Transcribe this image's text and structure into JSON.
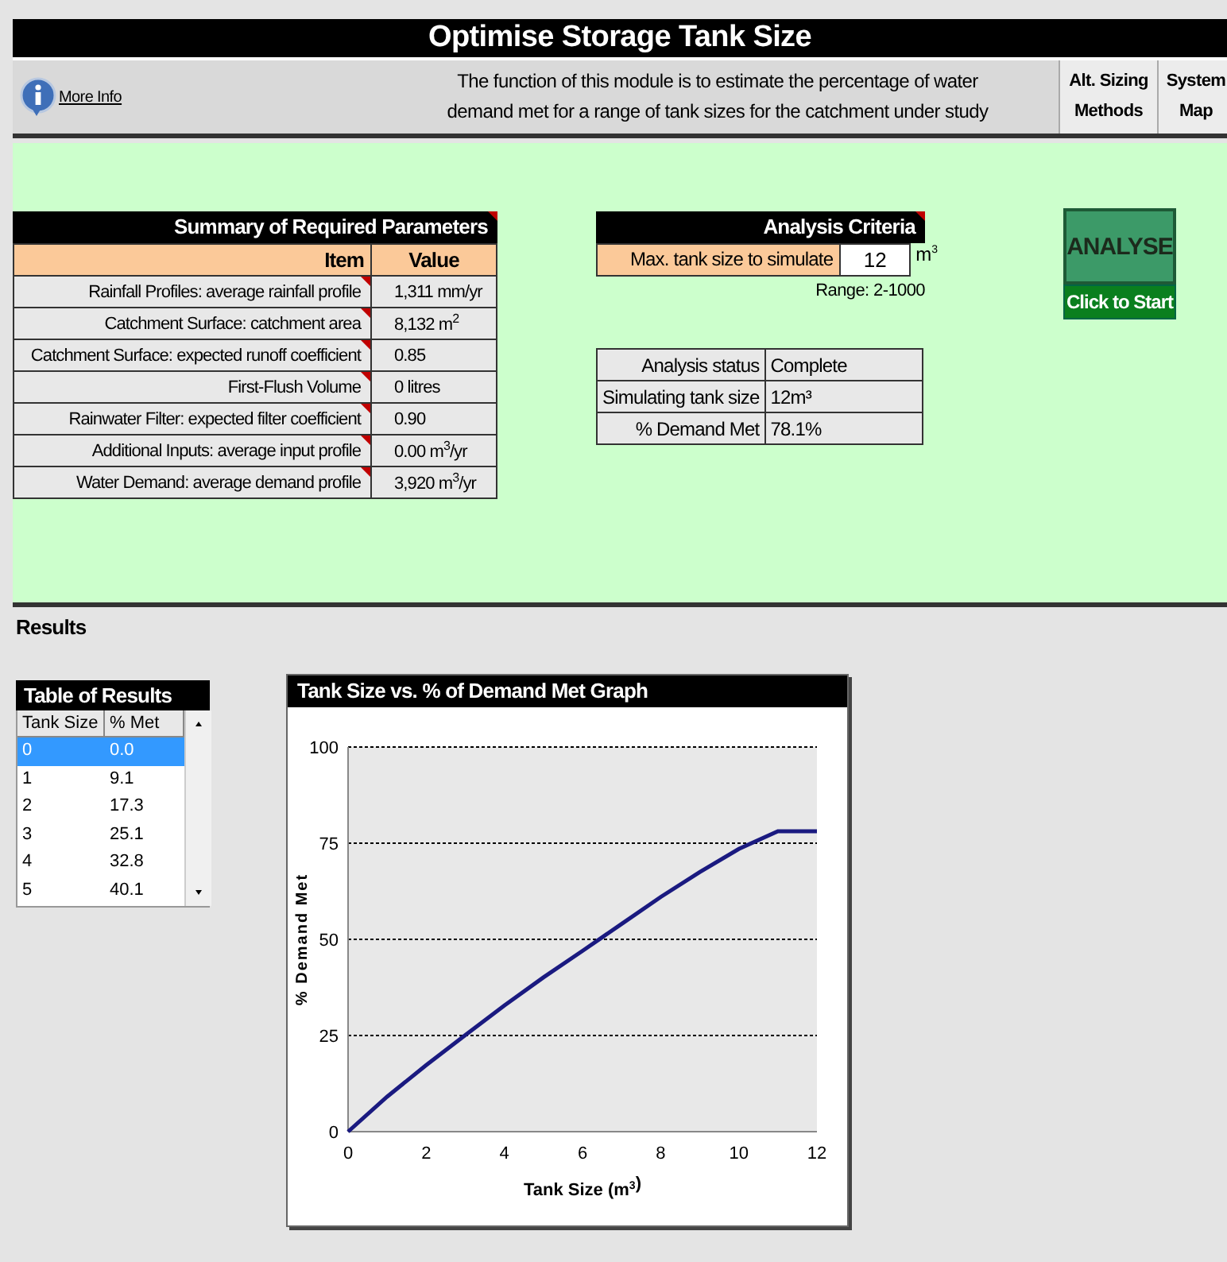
{
  "title": "Optimise Storage Tank Size",
  "info_link": "More Info",
  "description_lines": [
    "The function of this module is to estimate the percentage of water",
    "demand met for a range of tank sizes for the catchment under study"
  ],
  "nav_buttons": [
    {
      "lines": [
        "Alt. Sizing",
        "Methods"
      ]
    },
    {
      "lines": [
        "System",
        "Map"
      ]
    }
  ],
  "summary": {
    "title": "Summary of Required Parameters",
    "has_comment": true,
    "columns": [
      "Item",
      "Value"
    ],
    "rows": [
      {
        "item": "Rainfall Profiles: average rainfall profile",
        "value": "1,311 mm/yr",
        "has_comment": true
      },
      {
        "item": "Catchment Surface: catchment area",
        "value": "8,132 m$^{2}$",
        "has_comment": true
      },
      {
        "item": "Catchment Surface: expected runoff coefficient",
        "value": "0.85",
        "has_comment": true
      },
      {
        "item": "First-Flush Volume",
        "value": "0 litres",
        "has_comment": true
      },
      {
        "item": "Rainwater Filter: expected filter coefficient",
        "value": "0.90",
        "has_comment": true
      },
      {
        "item": "Additional Inputs: average input profile",
        "value": "0.00 m$^{3}$/yr",
        "has_comment": true
      },
      {
        "item": "Water Demand: average demand profile",
        "value": "3,920 m$^{3}$/yr",
        "has_comment": true
      }
    ]
  },
  "criteria": {
    "title": "Analysis Criteria",
    "has_comment": true,
    "label": "Max. tank size to simulate",
    "value": "12",
    "unit": "m$^{3}$",
    "range": "Range: 2-1000"
  },
  "status": [
    {
      "label": "Analysis status",
      "value": "Complete"
    },
    {
      "label": "Simulating tank size",
      "value": "12m³"
    },
    {
      "label": "% Demand Met",
      "value": "78.1%"
    }
  ],
  "analyse_button": {
    "label": "ANALYSE",
    "caption": "Click to Start"
  },
  "results": {
    "heading": "Results",
    "table_title": "Table of Results",
    "columns": [
      "Tank Size",
      "% Met"
    ],
    "rows": [
      {
        "size": "0",
        "met": "0.0",
        "selected": true
      },
      {
        "size": "1",
        "met": "9.1",
        "selected": false
      },
      {
        "size": "2",
        "met": "17.3",
        "selected": false
      },
      {
        "size": "3",
        "met": "25.1",
        "selected": false
      },
      {
        "size": "4",
        "met": "32.8",
        "selected": false
      },
      {
        "size": "5",
        "met": "40.1",
        "selected": false
      }
    ]
  },
  "graph": {
    "title": "Tank Size vs. % of Demand Met Graph",
    "chart_data": {
      "type": "line",
      "xlabel": "Tank Size (m$^{3}$)",
      "ylabel": "% Demand Met",
      "x": [
        0,
        1,
        2,
        3,
        4,
        5,
        6,
        7,
        8,
        9,
        10,
        11,
        12
      ],
      "grid": true,
      "series": [
        {
          "color": "#1a1a80",
          "values": [
            0,
            9.1,
            17.3,
            25.1,
            32.8,
            40.1,
            47,
            54,
            61,
            67.5,
            73.5,
            78.1,
            78.1
          ]
        }
      ],
      "xlim": [
        0,
        12
      ],
      "ylim": [
        0,
        100
      ],
      "xticks": [
        0,
        2,
        4,
        6,
        8,
        10,
        12
      ],
      "yticks": [
        0,
        25,
        50,
        75,
        100
      ]
    }
  }
}
